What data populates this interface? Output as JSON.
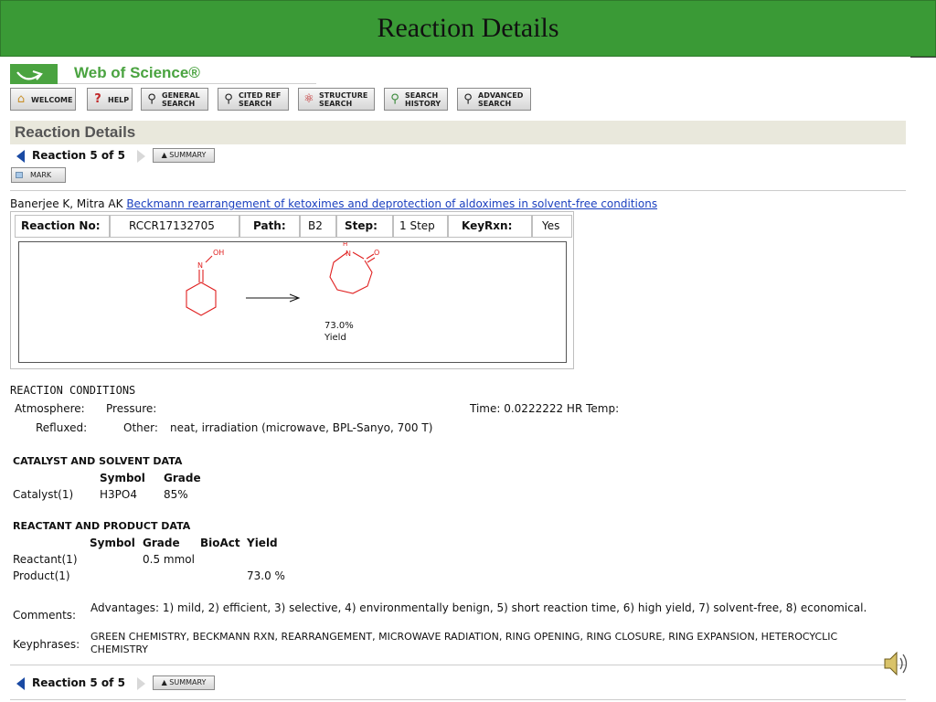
{
  "slide": {
    "title": "Reaction Details"
  },
  "brand": {
    "name": "Web of Science®",
    "color": "#4aa340"
  },
  "toolbar": [
    {
      "id": "welcome",
      "label": "WELCOME",
      "icon": "home-icon"
    },
    {
      "id": "help",
      "label": "HELP",
      "icon": "question-icon"
    },
    {
      "id": "general-search",
      "label": "GENERAL\nSEARCH",
      "icon": "magnifier-icon"
    },
    {
      "id": "cited-ref-search",
      "label": "CITED REF\nSEARCH",
      "icon": "magnifier-icon"
    },
    {
      "id": "structure-search",
      "label": "STRUCTURE\nSEARCH",
      "icon": "structure-icon"
    },
    {
      "id": "search-history",
      "label": "SEARCH\nHISTORY",
      "icon": "history-icon"
    },
    {
      "id": "advanced-search",
      "label": "ADVANCED\nSEARCH",
      "icon": "magnifier-icon"
    }
  ],
  "page": {
    "heading": "Reaction Details"
  },
  "nav": {
    "label": "Reaction 5 of 5",
    "summary": "▲ SUMMARY"
  },
  "mark": {
    "label": "MARK"
  },
  "citation": {
    "authors": "Banerjee K, Mitra AK",
    "title": "Beckmann rearrangement of ketoximes and deprotection of aldoximes in solvent-free conditions"
  },
  "reaction": {
    "no_label": "Reaction No:",
    "no_value": "RCCR17132705",
    "path_label": "Path:",
    "path_value": "B2",
    "step_label": "Step:",
    "step_value": "1 Step",
    "keyrxn_label": "KeyRxn:",
    "keyrxn_value": "Yes",
    "reactant_n": "N",
    "reactant_oh": "OH",
    "product_n": "N",
    "product_h": "H",
    "product_o": "O",
    "yield_value": "73.0%",
    "yield_label": "Yield",
    "structure_color": "#e02020"
  },
  "conditions": {
    "title": "REACTION CONDITIONS",
    "atmosphere": "Atmosphere:",
    "pressure": "Pressure:",
    "time": "Time:  0.0222222 HR  Temp:",
    "refluxed": "Refluxed:",
    "other_label": "Other:",
    "other_value": "neat, irradiation (microwave, BPL-Sanyo, 700 T)"
  },
  "catalyst": {
    "title": "CATALYST AND SOLVENT DATA",
    "col_symbol": "Symbol",
    "col_grade": "Grade",
    "row_label": "Catalyst(1)",
    "row_symbol": "H3PO4",
    "row_grade": "85%"
  },
  "reactant_product": {
    "title": "REACTANT AND PRODUCT DATA",
    "col_symbol": "Symbol",
    "col_grade": "Grade",
    "col_bioact": "BioAct",
    "col_yield": "Yield",
    "reactant_label": "Reactant(1)",
    "reactant_grade": "0.5 mmol",
    "product_label": "Product(1)",
    "product_yield": "73.0 %"
  },
  "comments": {
    "label": "Comments:",
    "value": "Advantages: 1) mild, 2) efficient, 3) selective, 4) environmentally benign, 5) short reaction time, 6) high yield, 7) solvent-free, 8) economical."
  },
  "keyphrases": {
    "label": "Keyphrases:",
    "value": "GREEN CHEMISTRY, BECKMANN RXN, REARRANGEMENT, MICROWAVE RADIATION, RING OPENING, RING CLOSURE, RING EXPANSION, HETEROCYCLIC CHEMISTRY"
  },
  "audio": {
    "icon": "speaker-icon"
  }
}
